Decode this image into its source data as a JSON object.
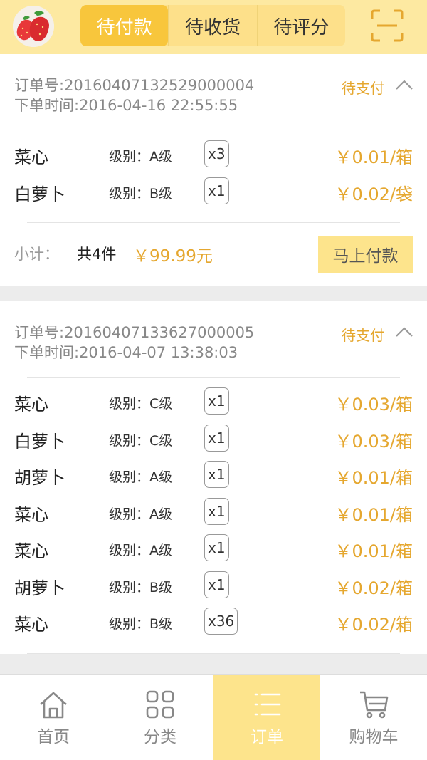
{
  "header": {
    "tabs": [
      {
        "label": "待付款",
        "active": true
      },
      {
        "label": "待收货",
        "active": false
      },
      {
        "label": "待评分",
        "active": false
      }
    ],
    "scan_icon": "scan-icon",
    "avatar_icon": "strawberry-avatar"
  },
  "orders": [
    {
      "order_no": "订单号:20160407132529000004",
      "order_time": "下单时间:2016-04-16 22:55:55",
      "status": "待支付",
      "items": [
        {
          "name": "菜心",
          "grade": "级别：A级",
          "qty": "x3",
          "price": "￥0.01/箱"
        },
        {
          "name": "白萝卜",
          "grade": "级别：B级",
          "qty": "x1",
          "price": "￥0.02/袋"
        }
      ],
      "subtotal_label": "小计：",
      "count": "共4件",
      "amount": "￥99.99元",
      "pay_label": "马上付款"
    },
    {
      "order_no": "订单号:20160407133627000005",
      "order_time": "下单时间:2016-04-07 13:38:03",
      "status": "待支付",
      "items": [
        {
          "name": "菜心",
          "grade": "级别：C级",
          "qty": "x1",
          "price": "￥0.03/箱"
        },
        {
          "name": "白萝卜",
          "grade": "级别：C级",
          "qty": "x1",
          "price": "￥0.03/箱"
        },
        {
          "name": "胡萝卜",
          "grade": "级别：A级",
          "qty": "x1",
          "price": "￥0.01/箱"
        },
        {
          "name": "菜心",
          "grade": "级别：A级",
          "qty": "x1",
          "price": "￥0.01/箱"
        },
        {
          "name": "菜心",
          "grade": "级别：A级",
          "qty": "x1",
          "price": "￥0.01/箱"
        },
        {
          "name": "胡萝卜",
          "grade": "级别：B级",
          "qty": "x1",
          "price": "￥0.02/箱"
        },
        {
          "name": "菜心",
          "grade": "级别：B级",
          "qty": "x36",
          "price": "￥0.02/箱"
        }
      ]
    }
  ],
  "nav": [
    {
      "label": "首页",
      "icon": "home-icon",
      "active": false
    },
    {
      "label": "分类",
      "icon": "category-icon",
      "active": false
    },
    {
      "label": "订单",
      "icon": "order-list-icon",
      "active": true
    },
    {
      "label": "购物车",
      "icon": "cart-icon",
      "active": false
    }
  ],
  "colors": {
    "header_bg": "#fde9a1",
    "tab_active": "#f8c63c",
    "accent_text": "#e5a72f",
    "pay_button": "#fde48c"
  }
}
